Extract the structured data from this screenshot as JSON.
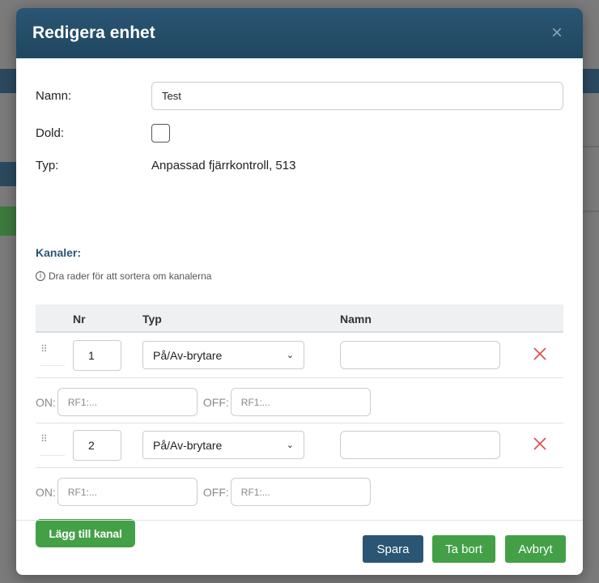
{
  "dialog": {
    "title": "Redigera enhet",
    "close_symbol": "×"
  },
  "form": {
    "name_label": "Namn:",
    "name_value": "Test",
    "hidden_label": "Dold:",
    "hidden_checked": false,
    "type_label": "Typ:",
    "type_value": "Anpassad fjärrkontroll, 513"
  },
  "channels": {
    "section_title": "Kanaler:",
    "hint": "Dra rader för att sortera om kanalerna",
    "columns": {
      "nr": "Nr",
      "type": "Typ",
      "name": "Namn"
    },
    "rows": [
      {
        "nr": "1",
        "type": "På/Av-brytare",
        "name": "",
        "on_label": "ON:",
        "on_placeholder": "RF1:...",
        "off_label": "OFF:",
        "off_placeholder": "RF1:..."
      },
      {
        "nr": "2",
        "type": "På/Av-brytare",
        "name": "",
        "on_label": "ON:",
        "on_placeholder": "RF1:...",
        "off_label": "OFF:",
        "off_placeholder": "RF1:..."
      }
    ],
    "add_button": "Lägg till kanal"
  },
  "footer": {
    "save": "Spara",
    "delete": "Ta bort",
    "cancel": "Avbryt"
  },
  "colors": {
    "header": "#2a5573",
    "primary": "#2a5573",
    "success": "#43a047",
    "danger": "#d9534f"
  },
  "icons": {
    "close": "close-icon",
    "info": "info-icon",
    "drag": "drag-handle-icon",
    "delete": "delete-x-icon",
    "chevron": "chevron-down-icon"
  }
}
